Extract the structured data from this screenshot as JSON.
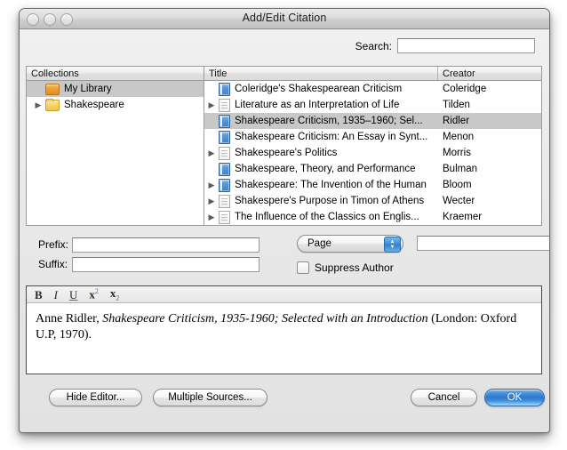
{
  "window": {
    "title": "Add/Edit Citation",
    "controls": [
      "close-button",
      "minimize-button",
      "zoom-button"
    ]
  },
  "search": {
    "label": "Search:",
    "value": "",
    "placeholder": ""
  },
  "collections": {
    "header": "Collections",
    "items": [
      {
        "label": "My Library",
        "icon": "library-icon",
        "selected": true,
        "expandable": false
      },
      {
        "label": "Shakespeare",
        "icon": "folder-icon",
        "selected": false,
        "expandable": true
      }
    ]
  },
  "titles": {
    "headers": {
      "title": "Title",
      "creator": "Creator"
    },
    "rows": [
      {
        "title": "Coleridge's Shakespearean Criticism",
        "creator": "Coleridge",
        "icon": "book-icon",
        "expandable": false,
        "selected": false
      },
      {
        "title": "Literature as an Interpretation of Life",
        "creator": "Tilden",
        "icon": "document-icon",
        "expandable": true,
        "selected": false
      },
      {
        "title": "Shakespeare Criticism, 1935–1960; Sel...",
        "creator": "Ridler",
        "icon": "book-icon",
        "expandable": false,
        "selected": true
      },
      {
        "title": "Shakespeare Criticism: An Essay in Synt...",
        "creator": "Menon",
        "icon": "book-icon",
        "expandable": false,
        "selected": false
      },
      {
        "title": "Shakespeare's Politics",
        "creator": "Morris",
        "icon": "document-icon",
        "expandable": true,
        "selected": false
      },
      {
        "title": "Shakespeare, Theory, and Performance",
        "creator": "Bulman",
        "icon": "book-icon",
        "expandable": false,
        "selected": false
      },
      {
        "title": "Shakespeare: The Invention of the Human",
        "creator": "Bloom",
        "icon": "book-icon",
        "expandable": true,
        "selected": false
      },
      {
        "title": "Shakespere's Purpose in Timon of Athens",
        "creator": "Wecter",
        "icon": "document-icon",
        "expandable": true,
        "selected": false
      },
      {
        "title": "The Influence of the Classics on Englis...",
        "creator": "Kraemer",
        "icon": "document-icon",
        "expandable": true,
        "selected": false
      }
    ]
  },
  "fields": {
    "prefix_label": "Prefix:",
    "prefix_value": "",
    "suffix_label": "Suffix:",
    "suffix_value": "",
    "locator_type": "Page",
    "locator_value": "",
    "suppress_author_label": "Suppress Author",
    "suppress_author_checked": false
  },
  "editor": {
    "toolbar": {
      "bold": "B",
      "italic": "I",
      "underline": "U",
      "superscript_base": "x",
      "superscript_exp": "2",
      "subscript_base": "x",
      "subscript_exp": "2"
    },
    "citation": {
      "author": "Anne Ridler, ",
      "title_italic": "Shakespeare Criticism, 1935-1960; Selected with an Introduction",
      "tail": " (London: Oxford U.P, 1970)."
    }
  },
  "buttons": {
    "hide_editor": "Hide Editor...",
    "multiple_sources": "Multiple Sources...",
    "cancel": "Cancel",
    "ok": "OK"
  },
  "colors": {
    "default_button": "#2b79cd",
    "selection": "#c8c8c8",
    "library_icon": "#efa037",
    "folder_icon": "#f9d468",
    "book_icon": "#3f7fc4"
  }
}
